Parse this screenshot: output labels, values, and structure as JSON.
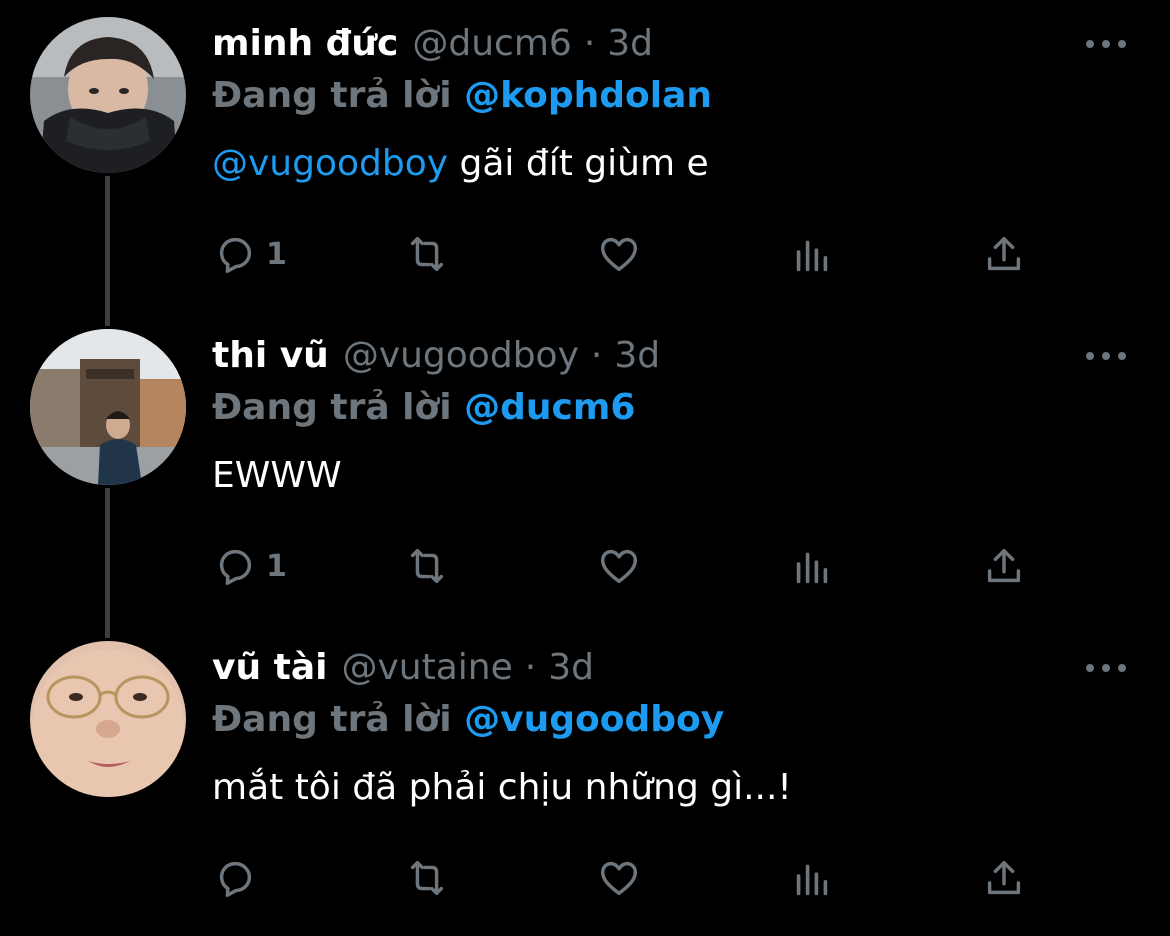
{
  "accent_color": "#1d9bf0",
  "muted_color": "#6e767d",
  "tweets": [
    {
      "display_name": "minh đức",
      "handle": "@ducm6",
      "separator": "·",
      "time": "3d",
      "reply_prefix": "Đang trả lời",
      "reply_to": "@kophdolan",
      "mention": "@vugoodboy",
      "text": " gãi đít giùm e",
      "reply_count": "1",
      "avatar_icon": "avatar-photo"
    },
    {
      "display_name": "thi vũ",
      "handle": "@vugoodboy",
      "separator": "·",
      "time": "3d",
      "reply_prefix": "Đang trả lời",
      "reply_to": "@ducm6",
      "mention": "",
      "text": "EWWW",
      "reply_count": "1",
      "avatar_icon": "avatar-photo"
    },
    {
      "display_name": "vũ tài",
      "handle": "@vutaine",
      "separator": "·",
      "time": "3d",
      "reply_prefix": "Đang trả lời",
      "reply_to": "@vugoodboy",
      "mention": "",
      "text": "mắt tôi đã phải chịu những gì...!",
      "reply_count": "",
      "avatar_icon": "avatar-photo"
    }
  ],
  "icons": {
    "more": "more-horizontal-icon",
    "reply": "reply-icon",
    "retweet": "retweet-icon",
    "like": "heart-icon",
    "stats": "analytics-icon",
    "share": "share-icon"
  }
}
